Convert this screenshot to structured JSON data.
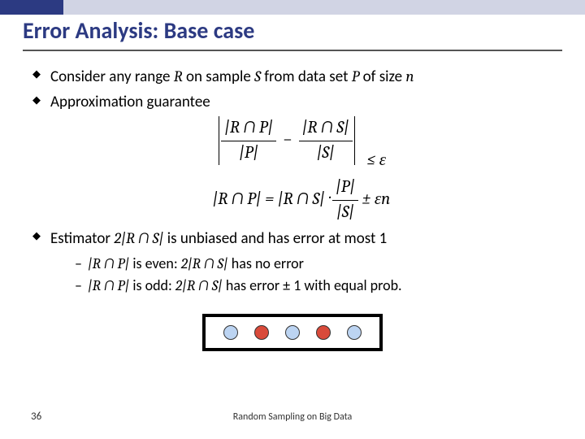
{
  "title": "Error Analysis: Base case",
  "bullets": {
    "b1_pre": "Consider any range ",
    "b1_R": "R",
    "b1_mid1": " on sample ",
    "b1_S": "S",
    "b1_mid2": " from data set ",
    "b1_P": "P",
    "b1_mid3": " of size ",
    "b1_n": "n",
    "b2": "Approximation guarantee",
    "b3_pre": "Estimator ",
    "b3_est": "2|R ∩ S|",
    "b3_post": " is unbiased and has error at most 1",
    "sub1_a": "|R ∩ P|",
    "sub1_b": " is even: ",
    "sub1_c": "2|R ∩ S|",
    "sub1_d": " has no error",
    "sub2_a": "|R ∩ P|",
    "sub2_b": " is odd: ",
    "sub2_c": "2|R ∩ S|",
    "sub2_d": " has error ± 1 with equal prob."
  },
  "math": {
    "eq1_num1": "|R ∩ P|",
    "eq1_den1": "|P|",
    "eq1_num2": "|R ∩ S|",
    "eq1_den2": "|S|",
    "eq1_rhs": "≤ ε",
    "eq2_lhs": "|R ∩ P| = |R ∩ S| · ",
    "eq2_num": "|P|",
    "eq2_den": "|S|",
    "eq2_tail": " ± εn"
  },
  "footer": {
    "page": "36",
    "text": "Random Sampling on Big Data"
  }
}
